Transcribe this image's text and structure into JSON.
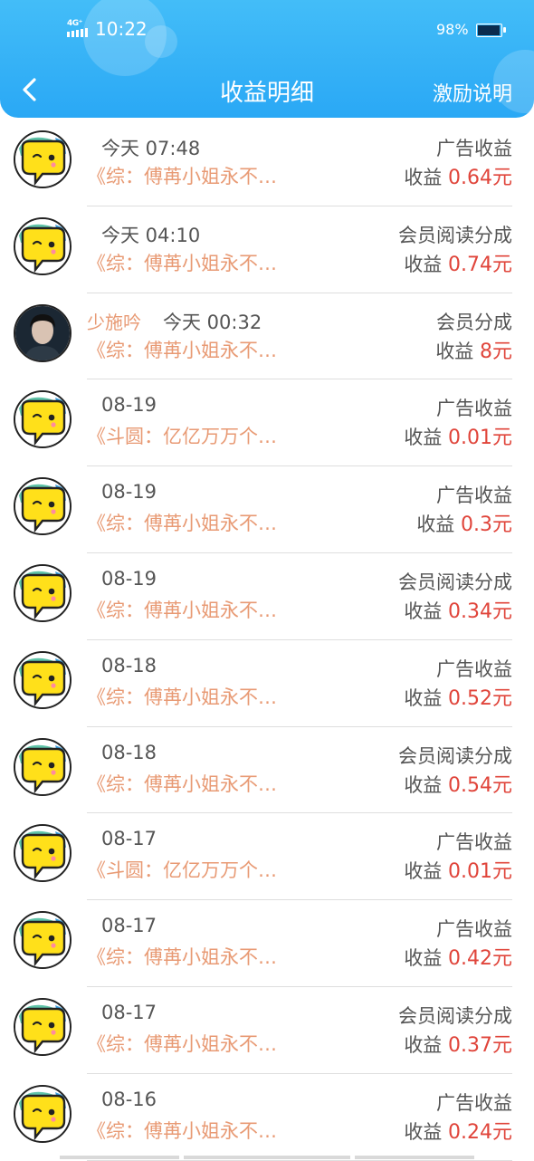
{
  "status_bar": {
    "network": "4G⁺",
    "time": "10:22",
    "battery": "98%"
  },
  "header": {
    "title": "收益明细",
    "help_label": "激励说明"
  },
  "earn_label": "收益",
  "colors": {
    "header": "#2aa8f5",
    "book": "#e89a74",
    "amount": "#e0453b"
  },
  "rows": [
    {
      "avatar": "mascot",
      "name": "",
      "time": "今天 07:48",
      "type": "广告收益",
      "book": "《综：傅苒小姐永不…",
      "amount": "0.64元"
    },
    {
      "avatar": "mascot",
      "name": "",
      "time": "今天 04:10",
      "type": "会员阅读分成",
      "book": "《综：傅苒小姐永不…",
      "amount": "0.74元"
    },
    {
      "avatar": "photo",
      "name": "少施吟",
      "time": "今天 00:32",
      "type": "会员分成",
      "book": "《综：傅苒小姐永不…",
      "amount": "8元"
    },
    {
      "avatar": "mascot",
      "name": "",
      "time": "08-19",
      "type": "广告收益",
      "book": "《斗圆：亿亿万万个…",
      "amount": "0.01元"
    },
    {
      "avatar": "mascot",
      "name": "",
      "time": "08-19",
      "type": "广告收益",
      "book": "《综：傅苒小姐永不…",
      "amount": "0.3元"
    },
    {
      "avatar": "mascot",
      "name": "",
      "time": "08-19",
      "type": "会员阅读分成",
      "book": "《综：傅苒小姐永不…",
      "amount": "0.34元"
    },
    {
      "avatar": "mascot",
      "name": "",
      "time": "08-18",
      "type": "广告收益",
      "book": "《综：傅苒小姐永不…",
      "amount": "0.52元"
    },
    {
      "avatar": "mascot",
      "name": "",
      "time": "08-18",
      "type": "会员阅读分成",
      "book": "《综：傅苒小姐永不…",
      "amount": "0.54元"
    },
    {
      "avatar": "mascot",
      "name": "",
      "time": "08-17",
      "type": "广告收益",
      "book": "《斗圆：亿亿万万个…",
      "amount": "0.01元"
    },
    {
      "avatar": "mascot",
      "name": "",
      "time": "08-17",
      "type": "广告收益",
      "book": "《综：傅苒小姐永不…",
      "amount": "0.42元"
    },
    {
      "avatar": "mascot",
      "name": "",
      "time": "08-17",
      "type": "会员阅读分成",
      "book": "《综：傅苒小姐永不…",
      "amount": "0.37元"
    },
    {
      "avatar": "mascot",
      "name": "",
      "time": "08-16",
      "type": "广告收益",
      "book": "《综：傅苒小姐永不…",
      "amount": "0.24元"
    }
  ]
}
